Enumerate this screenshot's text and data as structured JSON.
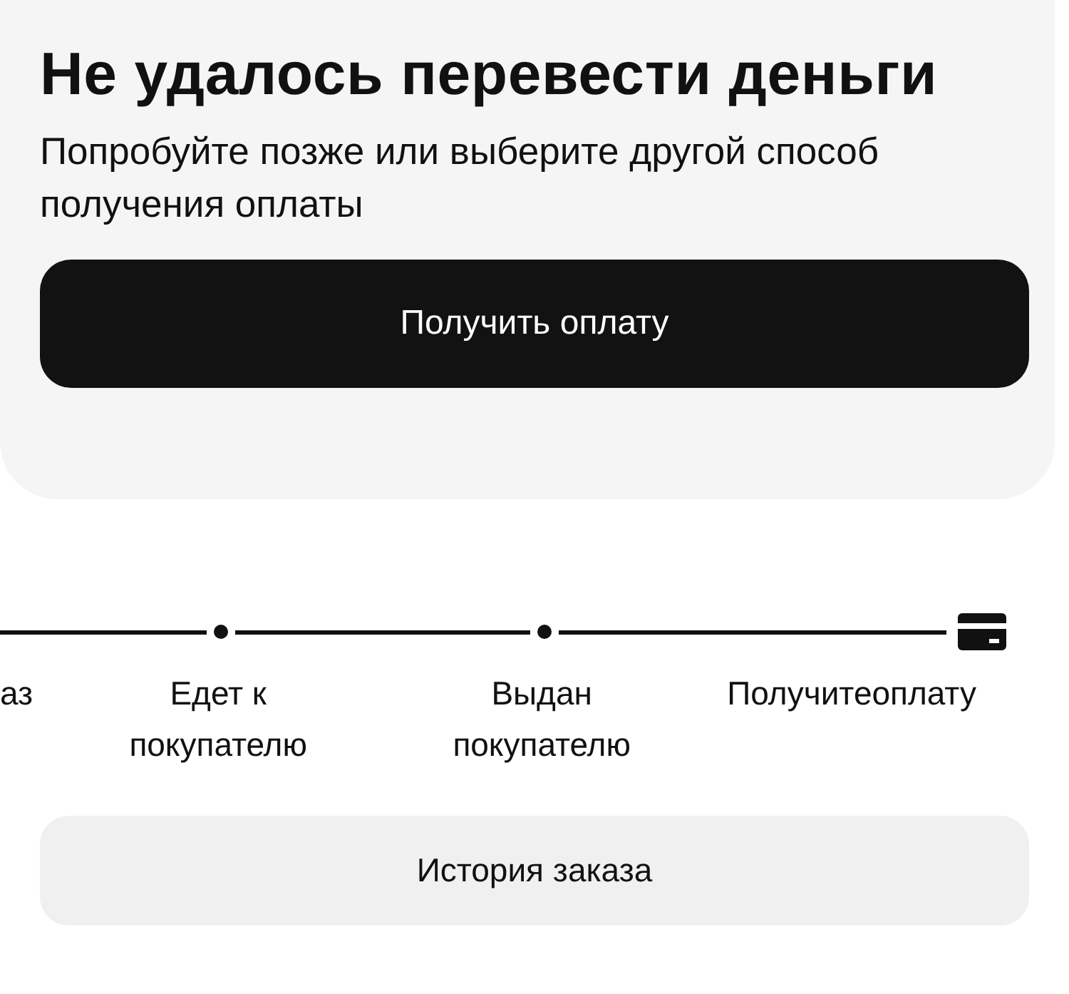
{
  "error_card": {
    "title": "Не удалось перевести деньги",
    "message": "Попробуйте позже или выберите другой способ получения оплаты",
    "button": "Получить оплату"
  },
  "steps": [
    {
      "label": "аз"
    },
    {
      "label": "Едет к покупателю",
      "kind": "dot"
    },
    {
      "label": "Выдан покупателю",
      "kind": "dot"
    },
    {
      "label": "Получитеоплату",
      "kind": "card"
    }
  ],
  "history_button": "История заказа"
}
